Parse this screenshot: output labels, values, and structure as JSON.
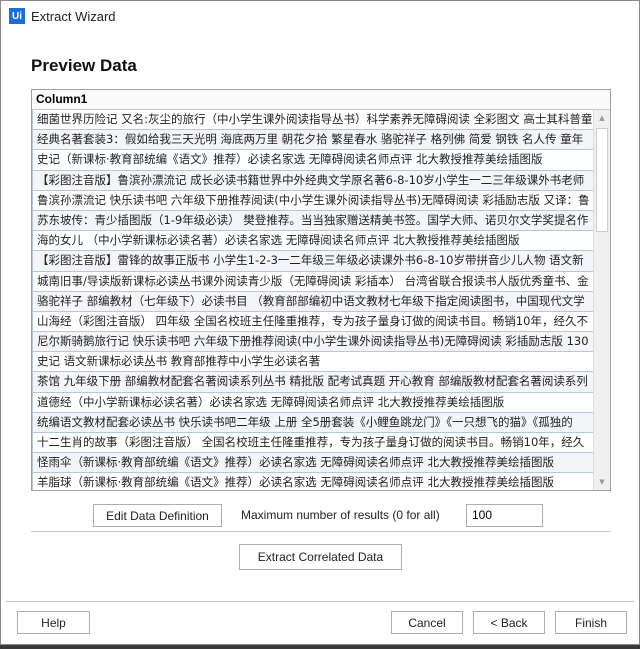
{
  "window": {
    "title": "Extract Wizard",
    "logo": "Ui"
  },
  "heading": "Preview Data",
  "table": {
    "column": "Column1",
    "rows": [
      "细菌世界历险记 又名:灰尘的旅行（中小学生课外阅读指导丛书）科学素养无障碍阅读 全彩图文 高士其科普童",
      "经典名著套装3：假如给我三天光明 海底两万里 朝花夕拾 繁星春水 骆驼祥子 格列佛 简爱 钢铁 名人传 童年",
      "史记（新课标·教育部统编《语文》推荐）必读名家选 无障碍阅读名师点评 北大教授推荐美绘插图版",
      "【彩图注音版】鲁滨孙漂流记 成长必读书籍世界中外经典文学原名著6-8-10岁小学生一二三年级课外书老师",
      "鲁滨孙漂流记 快乐读书吧 六年级下册推荐阅读(中小学生课外阅读指导丛书)无障碍阅读 彩插励志版 又译：鲁",
      "苏东坡传：青少插图版（1-9年级必读） 樊登推荐。当当独家赠送精美书签。国学大师、诺贝尔文学奖提名作",
      "海的女儿 （中小学新课标必读名著）必读名家选 无障碍阅读名师点评 北大教授推荐美绘插图版",
      "【彩图注音版】雷锋的故事正版书 小学生1-2-3一二年级三年级必读课外书6-8-10岁带拼音少儿人物 语文新",
      "城南旧事/导读版新课标必读丛书课外阅读青少版（无障碍阅读 彩插本） 台湾省联合报读书人版优秀童书、金",
      "骆驼祥子 部编教材（七年级下）必读书目 （教育部部编初中语文教材七年级下指定阅读图书，中国现代文学",
      "山海经（彩图注音版） 四年级 全国名校班主任隆重推荐，专为孩子量身订做的阅读书目。畅销10年，经久不",
      "尼尔斯骑鹅旅行记 快乐读书吧 六年级下册推荐阅读(中小学生课外阅读指导丛书)无障碍阅读 彩插励志版 130",
      "史记 语文新课标必读丛书 教育部推荐中小学生必读名著",
      "茶馆 九年级下册 部编教材配套名著阅读系列丛书 精批版 配考试真题 开心教育 部编版教材配套名著阅读系列",
      "道德经（中小学新课标必读名著）必读名家选 无障碍阅读名师点评 北大教授推荐美绘插图版",
      "统编语文教材配套必读丛书 快乐读书吧二年级 上册 全5册套装《小鲤鱼跳龙门》《一只想飞的猫》《孤独的",
      "十二生肖的故事（彩图注音版） 全国名校班主任隆重推荐，专为孩子量身订做的阅读书目。畅销10年，经久",
      "怪雨伞（新课标·教育部统编《语文》推荐）必读名家选 无障碍阅读名师点评 北大教授推荐美绘插图版",
      "羊脂球（新课标·教育部统编《语文》推荐）必读名家选 无障碍阅读名师点评 北大教授推荐美绘插图版"
    ]
  },
  "buttons": {
    "edit": "Edit Data Definition",
    "extract": "Extract Correlated Data",
    "help": "Help",
    "cancel": "Cancel",
    "back": "< Back",
    "finish": "Finish"
  },
  "max_results": {
    "label": "Maximum number of results (0 for all)",
    "value": "100"
  }
}
